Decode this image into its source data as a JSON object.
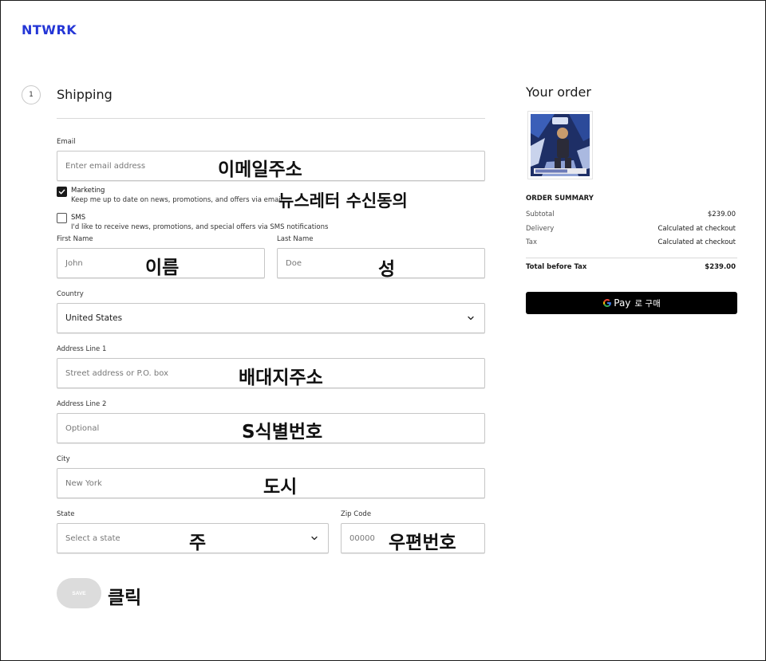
{
  "brand": {
    "logo": "NTWRK",
    "color": "#2436d6"
  },
  "shipping": {
    "step_number": "1",
    "title": "Shipping",
    "email": {
      "label": "Email",
      "placeholder": "Enter email address",
      "annotation": "이메일주소"
    },
    "marketing": {
      "checked": true,
      "title": "Marketing",
      "description": "Keep me up to date on news, promotions, and offers via email",
      "annotation": "뉴스레터 수신동의"
    },
    "sms": {
      "checked": false,
      "title": "SMS",
      "description": "I'd like to receive news, promotions, and special offers via SMS notifications"
    },
    "first_name": {
      "label": "First Name",
      "placeholder": "John",
      "annotation": "이름"
    },
    "last_name": {
      "label": "Last Name",
      "placeholder": "Doe",
      "annotation": "성"
    },
    "country": {
      "label": "Country",
      "value": "United States"
    },
    "address1": {
      "label": "Address Line 1",
      "placeholder": "Street address or P.O. box",
      "annotation": "배대지주소"
    },
    "address2": {
      "label": "Address Line 2",
      "placeholder": "Optional",
      "annotation": "S식별번호"
    },
    "city": {
      "label": "City",
      "placeholder": "New York",
      "annotation": "도시"
    },
    "state": {
      "label": "State",
      "placeholder": "Select a state",
      "annotation": "주"
    },
    "zip": {
      "label": "Zip Code",
      "placeholder": "00000",
      "annotation": "우편번호"
    },
    "save_label": "SAVE",
    "save_annotation": "클릭"
  },
  "order": {
    "title": "Your order",
    "product_image": "2021-22 NBA trading card box",
    "summary_title": "ORDER SUMMARY",
    "rows": [
      {
        "label": "Subtotal",
        "value": "$239.00"
      },
      {
        "label": "Delivery",
        "value": "Calculated at checkout"
      },
      {
        "label": "Tax",
        "value": "Calculated at checkout"
      }
    ],
    "total": {
      "label": "Total before Tax",
      "value": "$239.00"
    },
    "gpay": {
      "pay_text": "Pay",
      "kr_text": "로 구매"
    }
  }
}
